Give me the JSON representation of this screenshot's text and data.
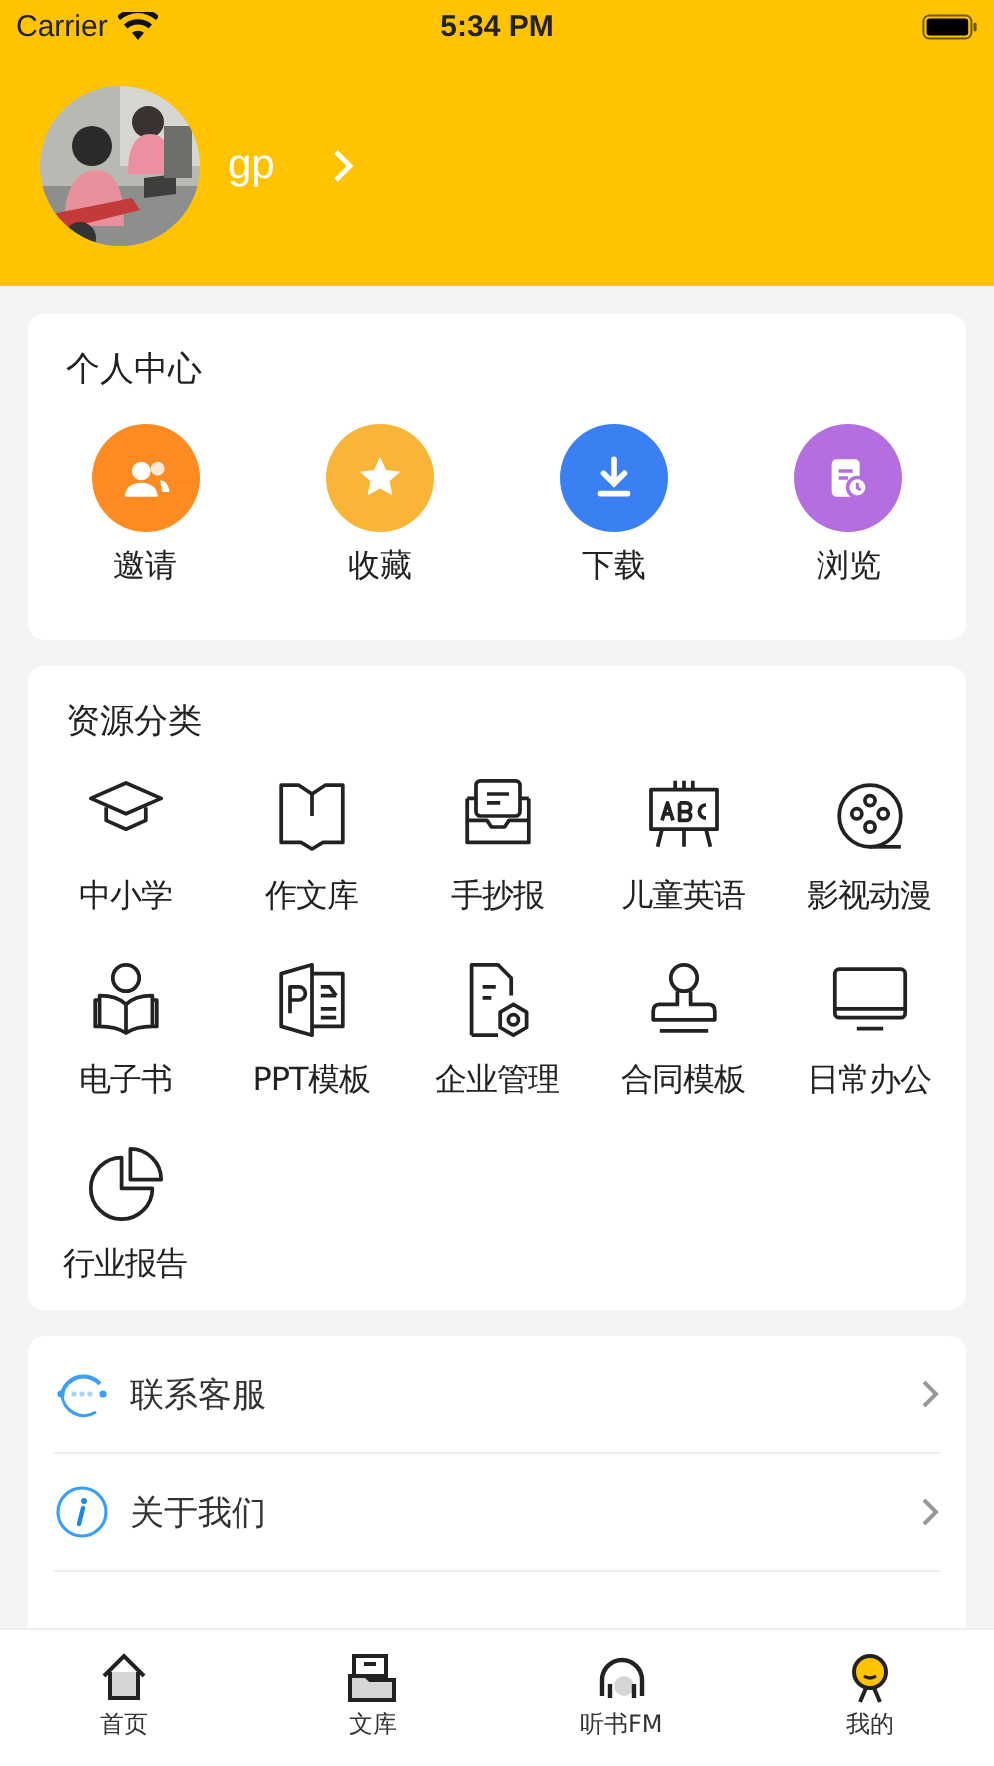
{
  "status_bar": {
    "carrier": "Carrier",
    "time": "5:34 PM"
  },
  "profile": {
    "username": "gp"
  },
  "personal_center": {
    "title": "个人中心",
    "items": [
      {
        "label": "邀请",
        "color": "#fe8a22"
      },
      {
        "label": "收藏",
        "color": "#f9b538"
      },
      {
        "label": "下载",
        "color": "#3a80f2"
      },
      {
        "label": "浏览",
        "color": "#b56ee0"
      }
    ]
  },
  "resource_categories": {
    "title": "资源分类",
    "items": [
      "中小学",
      "作文库",
      "手抄报",
      "儿童英语",
      "影视动漫",
      "电子书",
      "PPT模板",
      "企业管理",
      "合同模板",
      "日常办公",
      "行业报告"
    ]
  },
  "menu": [
    "联系客服",
    "关于我们"
  ],
  "tab_bar": [
    {
      "label": "首页",
      "selected": false
    },
    {
      "label": "文库",
      "selected": false
    },
    {
      "label": "听书FM",
      "selected": false
    },
    {
      "label": "我的",
      "selected": true
    }
  ]
}
